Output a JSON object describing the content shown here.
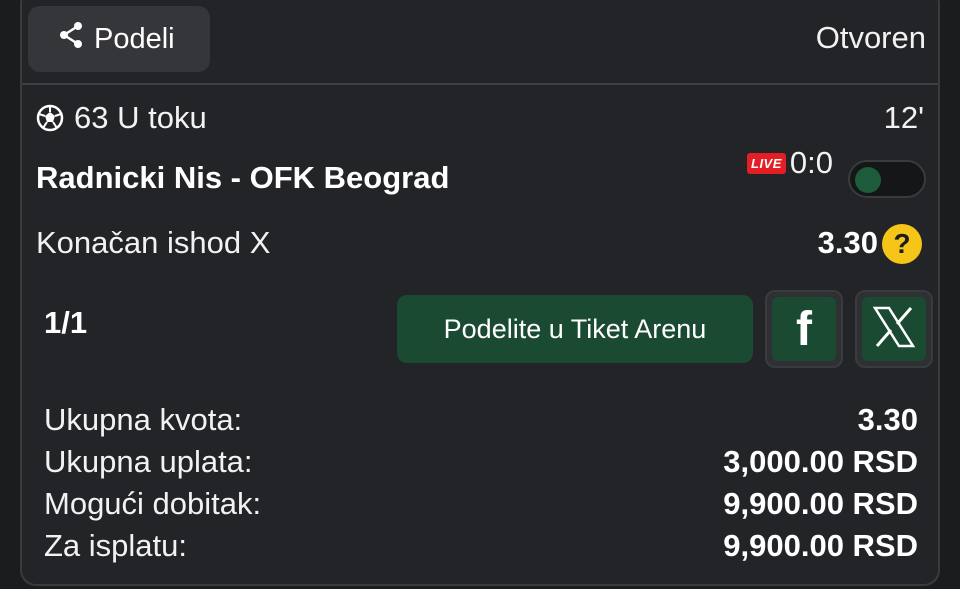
{
  "header": {
    "share_label": "Podeli",
    "status": "Otvoren"
  },
  "event": {
    "sport_icon": "soccer-ball-icon",
    "code_status": "63 U toku",
    "minute": "12'",
    "match": "Radnicki Nis - OFK Beograd",
    "live_label": "LIVE",
    "score": "0:0"
  },
  "bet": {
    "market": "Konačan ishod X",
    "odd": "3.30",
    "help_icon": "?"
  },
  "actions": {
    "counter": "1/1",
    "arena_label": "Podelite u Tiket Arenu",
    "facebook_icon": "f"
  },
  "summary": [
    {
      "label": "Ukupna kvota:",
      "value": "3.30"
    },
    {
      "label": "Ukupna uplata:",
      "value": "3,000.00 RSD"
    },
    {
      "label": "Mogući dobitak:",
      "value": "9,900.00 RSD"
    },
    {
      "label": "Za isplatu:",
      "value": "9,900.00 RSD"
    }
  ],
  "colors": {
    "background": "#1b1c1e",
    "card": "#232427",
    "accent_green": "#1b4a33",
    "live_red": "#e31e24",
    "help_yellow": "#f5c518"
  }
}
